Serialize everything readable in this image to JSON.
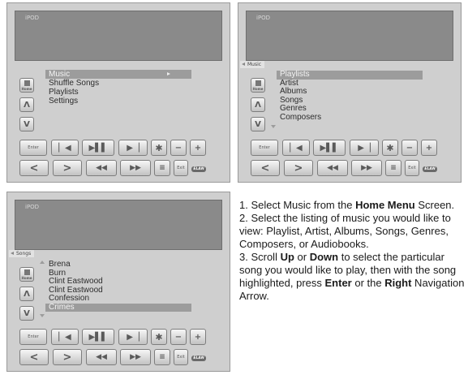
{
  "panel_home": {
    "screen_title": "iPOD",
    "menu": [
      "Music",
      "Shuffle Songs",
      "Playlists",
      "Settings"
    ]
  },
  "panel_music": {
    "screen_title": "iPOD",
    "breadcrumb": "Music",
    "menu": [
      "Playlists",
      "Artist",
      "Albums",
      "Songs",
      "Genres",
      "Composers"
    ]
  },
  "panel_songs": {
    "screen_title": "iPOD",
    "breadcrumb": "Songs",
    "menu": [
      "Brena",
      "Burn",
      "Clint Eastwood",
      "Clint Eastwood",
      "Confession",
      "Crimes"
    ]
  },
  "keypad": {
    "home": "Home",
    "enter": "Enter",
    "exit": "Exit",
    "logo": "ELAN",
    "up": "Λ",
    "down": "V",
    "prev": "●",
    "left": "<",
    "right": ">"
  },
  "caption": {
    "s1_a": "1. Select Music from the ",
    "s1_b": "Home Menu",
    "s1_c": " Screen.",
    "s2": "2. Select the listing of music you would like to view: Playlist, Artist, Albums, Songs, Genres, Composers, or Audiobooks.",
    "s3_a": "3. Scroll ",
    "s3_b": "Up",
    "s3_c": " or ",
    "s3_d": "Down",
    "s3_e": " to select the particular song you would like to play, then with the song highlighted, press ",
    "s3_f": "Enter",
    "s3_g": " or the ",
    "s3_h": "Right",
    "s3_i": "  Navigation Arrow."
  }
}
